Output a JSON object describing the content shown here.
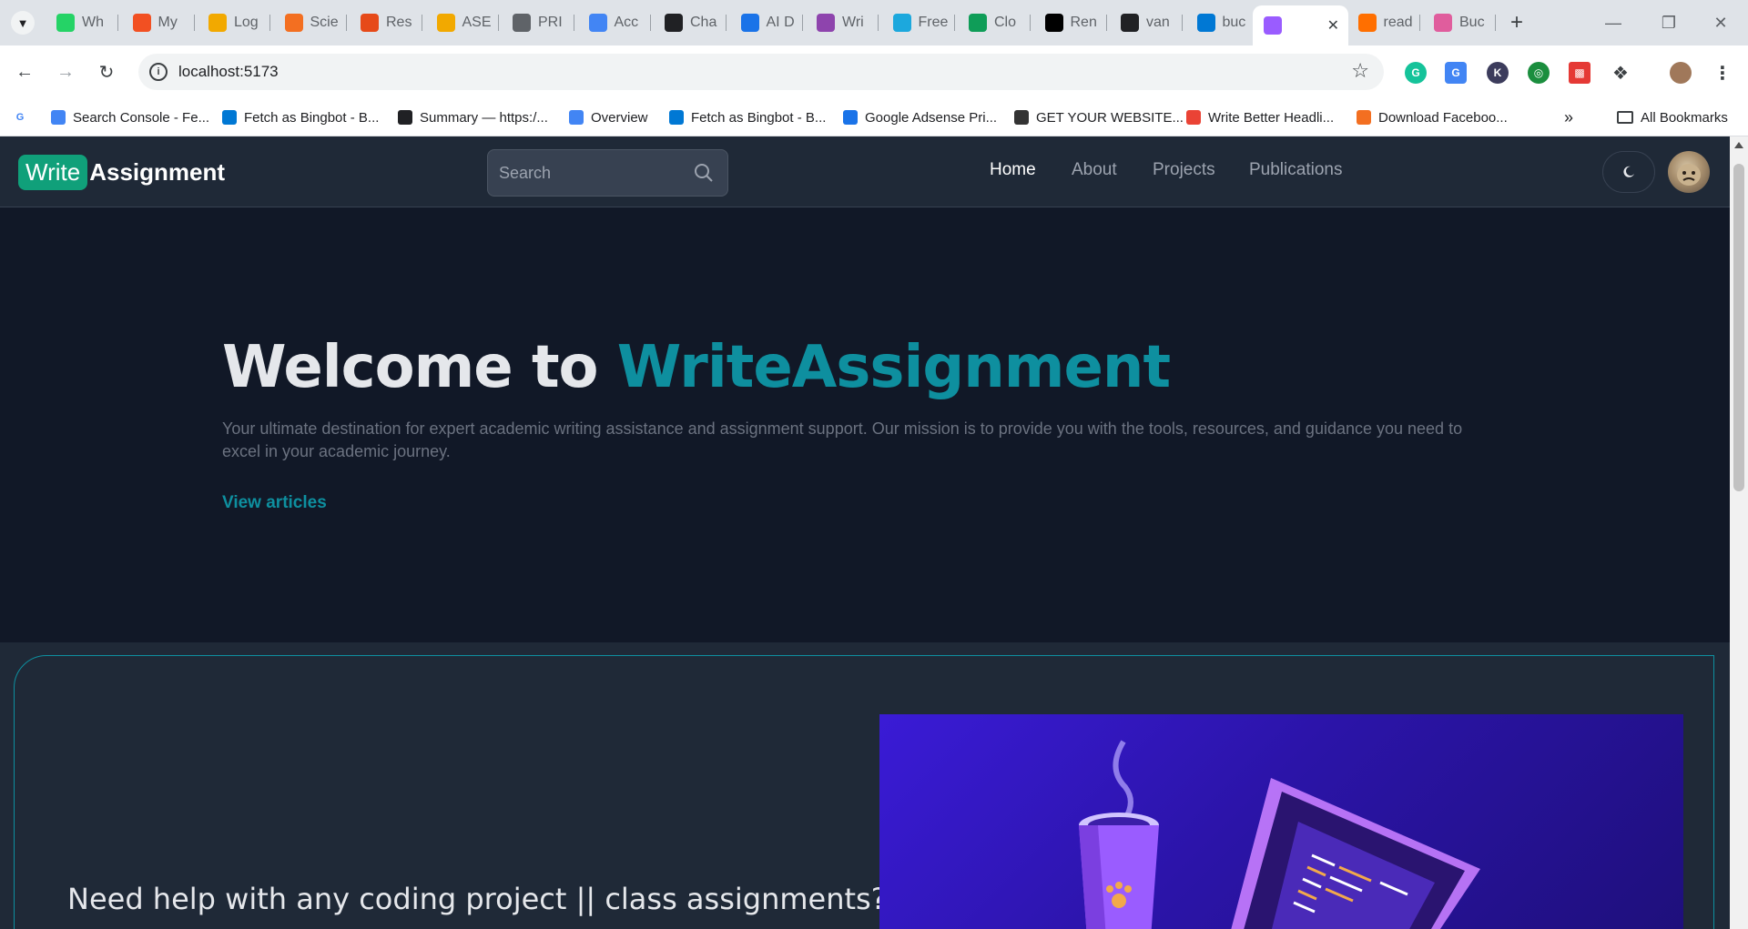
{
  "browser": {
    "tabs": [
      {
        "label": "Wh",
        "icon": "whatsapp-icon",
        "color": "#25d366"
      },
      {
        "label": "My",
        "icon": "microsoft-icon",
        "color": "#f25022"
      },
      {
        "label": "Log",
        "icon": "log-icon",
        "color": "#f2a900"
      },
      {
        "label": "Scie",
        "icon": "e-icon",
        "color": "#f36f21"
      },
      {
        "label": "Res",
        "icon": "e-red-icon",
        "color": "#e64a19"
      },
      {
        "label": "ASE",
        "icon": "ase-icon",
        "color": "#f2a900"
      },
      {
        "label": "PRI",
        "icon": "globe-icon",
        "color": "#5f6368"
      },
      {
        "label": "Acc",
        "icon": "docs-icon",
        "color": "#4285f4"
      },
      {
        "label": "Cha",
        "icon": "chatgpt-icon",
        "color": "#202124"
      },
      {
        "label": "AI D",
        "icon": "ai-icon",
        "color": "#1a73e8"
      },
      {
        "label": "Wri",
        "icon": "write-icon",
        "color": "#8e44ad"
      },
      {
        "label": "Free",
        "icon": "free-icon",
        "color": "#1ca8dd"
      },
      {
        "label": "Clo",
        "icon": "mongodb-icon",
        "color": "#0f9d58"
      },
      {
        "label": "Ren",
        "icon": "render-icon",
        "color": "#000000"
      },
      {
        "label": "van",
        "icon": "github-icon",
        "color": "#202124"
      },
      {
        "label": "buc",
        "icon": "azure-icon",
        "color": "#0078d4"
      },
      {
        "label": "",
        "icon": "vite-icon",
        "color": "#9a5cff",
        "active": true
      },
      {
        "label": "read",
        "icon": "firebase-icon",
        "color": "#ff6f00"
      },
      {
        "label": "Buc",
        "icon": "bucket-icon",
        "color": "#e05d9d"
      }
    ],
    "url": "localhost:5173",
    "bookmarks": [
      {
        "label": "Search Console - Fe...",
        "icon": "search-console-icon"
      },
      {
        "label": "Fetch as Bingbot - B...",
        "icon": "bing-icon"
      },
      {
        "label": "Summary — https:/...",
        "icon": "code-icon"
      },
      {
        "label": "Overview",
        "icon": "overview-icon"
      },
      {
        "label": "Fetch as Bingbot - B...",
        "icon": "bing-icon"
      },
      {
        "label": "Google Adsense Pri...",
        "icon": "adsense-icon"
      },
      {
        "label": "GET YOUR WEBSITE...",
        "icon": "website-icon"
      },
      {
        "label": "Write Better Headli...",
        "icon": "check-icon"
      },
      {
        "label": "Download Faceboo...",
        "icon": "fb-download-icon"
      }
    ],
    "all_bookmarks": "All Bookmarks"
  },
  "site": {
    "logo_write": "Write",
    "logo_assignment": "Assignment",
    "search_placeholder": "Search",
    "nav": [
      "Home",
      "About",
      "Projects",
      "Publications"
    ],
    "active_nav": "Home"
  },
  "hero": {
    "title_prefix": "Welcome to ",
    "title_brand": "WriteAssignment",
    "description": "Your ultimate destination for expert academic writing assistance and assignment support. Our mission is to provide you with the tools, resources, and guidance you need to excel in your academic journey.",
    "cta": "View articles"
  },
  "promo": {
    "heading": "Need help with any coding project || class assignments?"
  },
  "colors": {
    "accent": "#0e8f9f",
    "logo_bg": "#10a07a",
    "page_bg": "#111827",
    "nav_bg": "#1f2937"
  }
}
